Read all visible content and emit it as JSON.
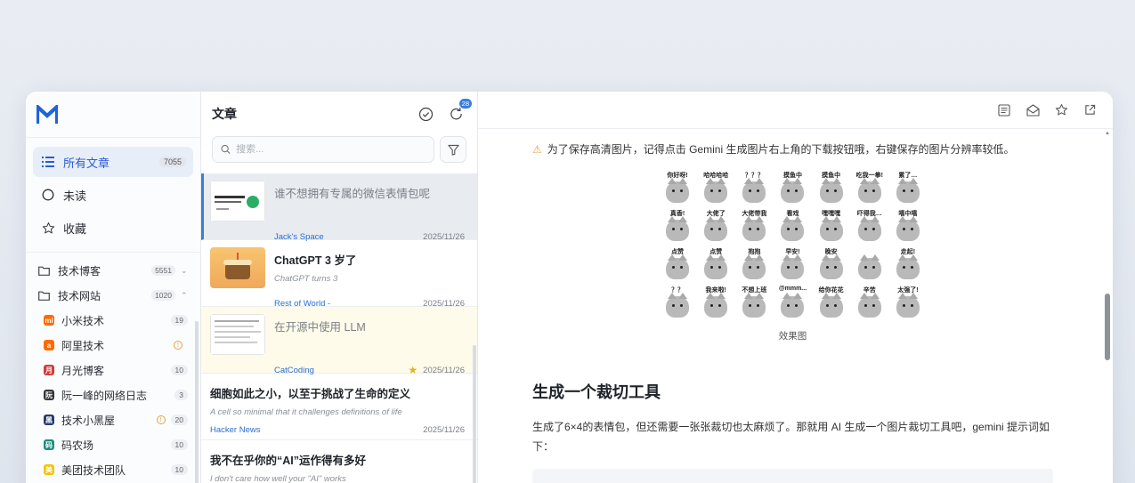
{
  "sidebar": {
    "nav": [
      {
        "label": "所有文章",
        "count": "7055",
        "icon": "list-icon",
        "active": true
      },
      {
        "label": "未读",
        "count": "",
        "icon": "circle-icon",
        "active": false
      },
      {
        "label": "收藏",
        "count": "",
        "icon": "star-icon",
        "active": false
      }
    ],
    "folders": [
      {
        "label": "技术博客",
        "count": "5551",
        "expanded": false
      },
      {
        "label": "技术网站",
        "count": "1020",
        "expanded": true
      }
    ],
    "feeds": [
      {
        "label": "小米技术",
        "count": "19",
        "color": "#ff6a00",
        "glyph": "mi",
        "warn": false
      },
      {
        "label": "阿里技术",
        "count": "",
        "color": "#ff6a00",
        "glyph": "a",
        "warn": true
      },
      {
        "label": "月光博客",
        "count": "10",
        "color": "#d63b3b",
        "glyph": "月",
        "warn": false
      },
      {
        "label": "阮一峰的网络日志",
        "count": "3",
        "color": "#333333",
        "glyph": "阮",
        "warn": false
      },
      {
        "label": "技术小黑屋",
        "count": "20",
        "color": "#2a3a6e",
        "glyph": "黑",
        "warn": true
      },
      {
        "label": "码农场",
        "count": "10",
        "color": "#1e8e7e",
        "glyph": "码",
        "warn": false
      },
      {
        "label": "美团技术团队",
        "count": "10",
        "color": "#f5c400",
        "glyph": "美",
        "warn": false
      }
    ]
  },
  "list": {
    "title": "文章",
    "sync_badge": "28",
    "search_placeholder": "搜索...",
    "articles": [
      {
        "title": "谁不想拥有专属的微信表情包呢",
        "subtitle": "",
        "source": "Jack's Space",
        "date": "2025/11/26",
        "read": true,
        "selected": true,
        "starred": false,
        "thumb": "wechat"
      },
      {
        "title": "ChatGPT 3 岁了",
        "subtitle": "ChatGPT turns 3",
        "source": "Rest of World -",
        "date": "2025/11/26",
        "read": false,
        "selected": false,
        "starred": false,
        "thumb": "cake"
      },
      {
        "title": "在开源中使用 LLM",
        "subtitle": "",
        "source": "CatCoding",
        "date": "2025/11/26",
        "read": true,
        "selected": false,
        "starred": true,
        "thumb": "doc"
      },
      {
        "title": "细胞如此之小，以至于挑战了生命的定义",
        "subtitle": "A cell so minimal that it challenges definitions of life",
        "source": "Hacker News",
        "date": "2025/11/26",
        "read": false,
        "selected": false,
        "starred": false,
        "thumb": ""
      },
      {
        "title": "我不在乎你的“AI”运作得有多好",
        "subtitle": "I don't care how well your \"AI\" works",
        "source": "Lobsters",
        "date": "2025/11/26",
        "read": false,
        "selected": false,
        "starred": false,
        "thumb": ""
      }
    ]
  },
  "reader": {
    "tip": "为了保存高清图片，记得点击 Gemini 生成图片右上角的下载按钮哦，右键保存的图片分辨率较低。",
    "stickers": [
      "你好呀!",
      "哈哈哈哈",
      "？？？",
      "摸鱼中",
      "摸鱼中",
      "吃我一拳!",
      "累了…",
      "真香!",
      "大佬了",
      "大佬带我",
      "看戏",
      "嘿嘿嘿",
      "吓得我…",
      "嘻中嘻",
      "点赞",
      "点赞",
      "抱抱",
      "早安!",
      "晚安",
      "",
      "走起!",
      "？？",
      "我来啦!",
      "不想上班",
      "@mmm...",
      "给你花花",
      "辛苦",
      "太强了!"
    ],
    "image_caption": "效果图",
    "heading": "生成一个裁切工具",
    "paragraph": "生成了6×4的表情包，但还需要一张张裁切也太麻烦了。那就用 AI 生成一个图片裁切工具吧，gemini 提示词如下："
  }
}
